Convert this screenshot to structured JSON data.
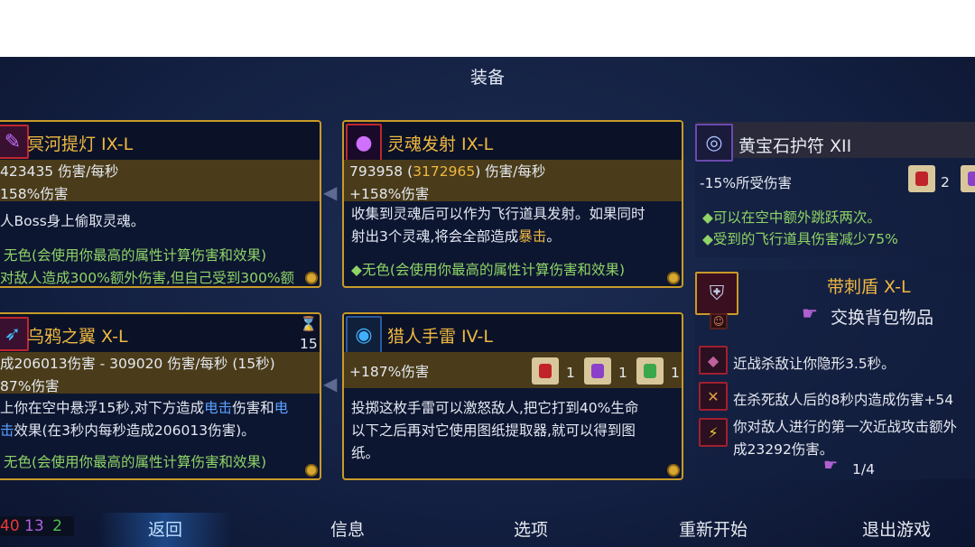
{
  "screen_title": "装备",
  "items": {
    "item1": {
      "name": "冥河提灯  IX-L",
      "dps_line": "423435 伤害/每秒",
      "bonus": "158%伤害",
      "desc1": "人Boss身上偷取灵魂。",
      "affix1": "无色(会使用你最高的属性计算伤害和效果)",
      "affix2": "对敌人造成300%额外伤害,但自己受到300%额"
    },
    "item2": {
      "name": "灵魂发射  IX-L",
      "dps_prefix": "793958 (",
      "dps_highlight": "3172965",
      "dps_suffix": ") 伤害/每秒",
      "bonus": "+158%伤害",
      "desc_line1": "收集到灵魂后可以作为飞行道具发射。如果同时",
      "desc_line2_a": "射出3个灵魂,将会全部造成",
      "desc_line2_hl": "暴击",
      "desc_line2_b": "。",
      "affix": "◆无色(会使用你最高的属性计算伤害和效果)"
    },
    "item3": {
      "name": "乌鸦之翼  X-L",
      "timer": "15",
      "dps_line": "成206013伤害 - 309020 伤害/每秒 (15秒)",
      "bonus": "87%伤害",
      "desc1_a": "上你在空中悬浮15秒,对下方造成",
      "desc1_hl": "电击",
      "desc1_b": "伤害和",
      "desc1_hl2": "电",
      "desc2_hl": "击",
      "desc2_b": "效果(在3秒内每秒造成206013伤害)。",
      "affix": "无色(会使用你最高的属性计算伤害和效果)"
    },
    "item4": {
      "name": "猎人手雷  IV-L",
      "bonus": "+187%伤害",
      "scroll_counts": [
        "1",
        "1",
        "1"
      ],
      "desc1": "投掷这枚手雷可以激怒敌人,把它打到40%生命",
      "desc2": "以下之后再对它使用图纸提取器,就可以得到图",
      "desc3": "纸。"
    }
  },
  "amulet": {
    "name": "黄宝石护符  XII",
    "stat": "-15%所受伤害",
    "scroll_count": "2",
    "perk1": "◆可以在空中额外跳跃两次。",
    "perk2": "◆受到的飞行道具伤害减少75%"
  },
  "shield_panel": {
    "name": "带刺盾  X-L",
    "swap_label": "交换背包物品",
    "mutations": [
      "近战杀敌让你隐形3.5秒。",
      "在杀死敌人后的8秒内造成伤害+54",
      "你对敌人进行的第一次近战攻击额外",
      "成23292伤害。"
    ],
    "backpack_count": "1/4"
  },
  "scrolls": {
    "red": "40",
    "purple": "13",
    "green": "2"
  },
  "menu": {
    "back": "返回",
    "info": "信息",
    "options": "选项",
    "restart": "重新开始",
    "quit": "退出游戏"
  },
  "colors": {
    "gold_border": "#c89a28",
    "item_name": "#f0b840",
    "affix_green": "#8ed466",
    "shock_blue": "#5aa0ff",
    "bg": "#142143"
  }
}
